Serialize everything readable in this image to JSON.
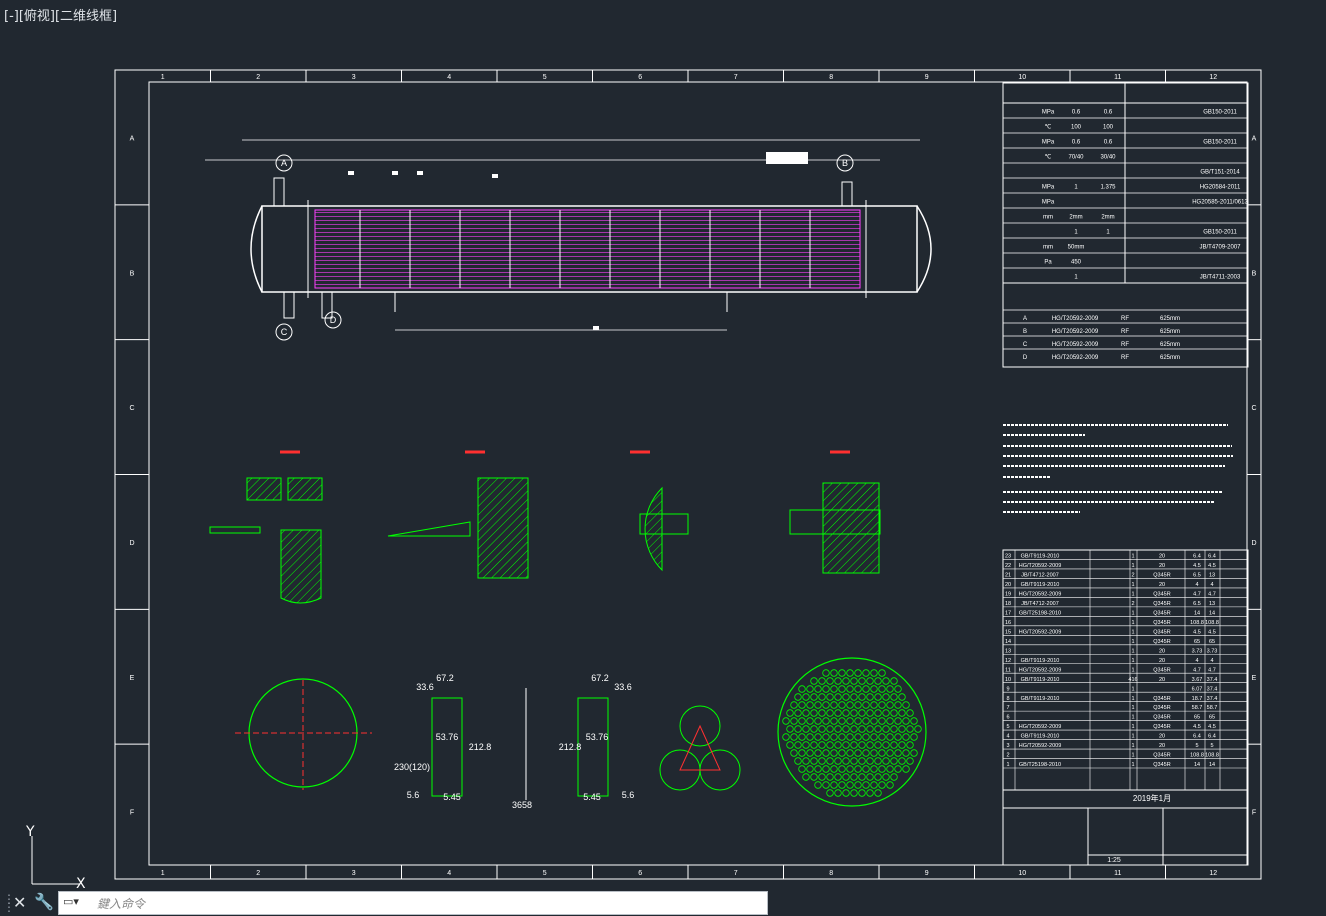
{
  "viewport": {
    "label": "[-][俯视][二维线框]"
  },
  "frame": {
    "columns": [
      "1",
      "2",
      "3",
      "4",
      "5",
      "6",
      "7",
      "8",
      "9",
      "10",
      "11",
      "12"
    ],
    "rows": [
      "A",
      "B",
      "C",
      "D",
      "E",
      "F"
    ]
  },
  "views": {
    "section_a": "A",
    "section_b": "B",
    "section_c": "C",
    "section_d": "D"
  },
  "plate_dims": {
    "d1": "33.6",
    "d2": "67.2",
    "d3": "53.76",
    "d4": "212.8",
    "d5": "230(120)",
    "d6": "5.6",
    "d7": "5.45",
    "e1": "67.2",
    "e2": "33.6",
    "e3": "53.76",
    "e4": "212.8",
    "e5": "5.45",
    "e6": "5.6",
    "span": "3658"
  },
  "table_rows": [
    [
      "23",
      "GB/T9119-2010",
      "",
      "1",
      "20",
      "6.4",
      "6.4"
    ],
    [
      "22",
      "HG/T20592-2009",
      "",
      "1",
      "20",
      "4.5",
      "4.5"
    ],
    [
      "21",
      "JB/T4712-2007",
      "",
      "2",
      "Q345R",
      "6.5",
      "13"
    ],
    [
      "20",
      "GB/T9119-2010",
      "",
      "1",
      "20",
      "4",
      "4"
    ],
    [
      "19",
      "HG/T20592-2009",
      "",
      "1",
      "Q345R",
      "4.7",
      "4.7"
    ],
    [
      "18",
      "JB/T4712-2007",
      "",
      "2",
      "Q345R",
      "6.5",
      "13"
    ],
    [
      "17",
      "GB/T25198-2010",
      "",
      "1",
      "Q345R",
      "14",
      "14"
    ],
    [
      "16",
      "",
      "",
      "1",
      "Q345R",
      "108.8",
      "108.8"
    ],
    [
      "15",
      "HG/T20592-2009",
      "",
      "1",
      "Q345R",
      "4.5",
      "4.5"
    ],
    [
      "14",
      "",
      "",
      "1",
      "Q345R",
      "65",
      "65"
    ],
    [
      "13",
      "",
      "",
      "1",
      "20",
      "3.73",
      "3.73"
    ],
    [
      "12",
      "GB/T9119-2010",
      "",
      "1",
      "20",
      "4",
      "4"
    ],
    [
      "11",
      "HG/T20592-2009",
      "",
      "1",
      "Q345R",
      "4.7",
      "4.7"
    ],
    [
      "10",
      "GB/T9119-2010",
      "",
      "416",
      "20",
      "3.67",
      "37.4"
    ],
    [
      "9",
      "",
      "",
      "1",
      "",
      "6.07",
      "37.4"
    ],
    [
      "8",
      "GB/T9119-2010",
      "",
      "1",
      "Q345R",
      "18.7",
      "37.4"
    ],
    [
      "7",
      "",
      "",
      "1",
      "Q345R",
      "58.7",
      "58.7"
    ],
    [
      "6",
      "",
      "",
      "1",
      "Q345R",
      "65",
      "65"
    ],
    [
      "5",
      "HG/T20592-2009",
      "",
      "1",
      "Q345R",
      "4.5",
      "4.5"
    ],
    [
      "4",
      "GB/T9119-2010",
      "",
      "1",
      "20",
      "6.4",
      "6.4"
    ],
    [
      "3",
      "HG/T20592-2009",
      "",
      "1",
      "20",
      "5",
      "5"
    ],
    [
      "2",
      "",
      "",
      "1",
      "Q345R",
      "108.8",
      "108.8"
    ],
    [
      "1",
      "GB/T25198-2010",
      "",
      "1",
      "Q345R",
      "14",
      "14"
    ]
  ],
  "nozzles": [
    [
      "A",
      "HG/T20592-2009",
      "RF",
      "625mm"
    ],
    [
      "B",
      "HG/T20592-2009",
      "RF",
      "625mm"
    ],
    [
      "C",
      "HG/T20592-2009",
      "RF",
      "625mm"
    ],
    [
      "D",
      "HG/T20592-2009",
      "RF",
      "625mm"
    ]
  ],
  "design_rows": [
    [
      "",
      "MPa",
      "0.6",
      "0.6",
      "",
      "GB150-2011"
    ],
    [
      "",
      "℃",
      "100",
      "100",
      "",
      ""
    ],
    [
      "",
      "MPa",
      "0.6",
      "0.6",
      "",
      "GB150-2011"
    ],
    [
      "",
      "℃",
      "70/40",
      "30/40",
      "",
      ""
    ],
    [
      "",
      "",
      "",
      "",
      "",
      "GB/T151-2014"
    ],
    [
      "",
      "MPa",
      "1",
      "1.375",
      "",
      "HG20584-2011"
    ],
    [
      "",
      "MPa",
      "",
      "",
      "",
      "HG20585-2011/0613"
    ],
    [
      "",
      "mm",
      "2mm",
      "2mm",
      "",
      ""
    ],
    [
      "",
      "",
      "1",
      "1",
      "",
      "GB150-2011"
    ],
    [
      "",
      "mm",
      "50mm",
      "",
      "",
      "JB/T4709-2007"
    ],
    [
      "",
      "Pa",
      "450",
      "",
      "",
      ""
    ],
    [
      "",
      "",
      "1",
      "",
      "",
      "JB/T4711-2003"
    ]
  ],
  "title_block": {
    "date": "2019年1月",
    "scale": "1:25"
  },
  "command": {
    "placeholder": "鍵入命令"
  },
  "colors": {
    "background": "#212830",
    "frame": "#ffffff",
    "green": "#00ff00",
    "magenta": "#ff00ff",
    "red": "#ff3030",
    "yellow": "#ffff00"
  }
}
